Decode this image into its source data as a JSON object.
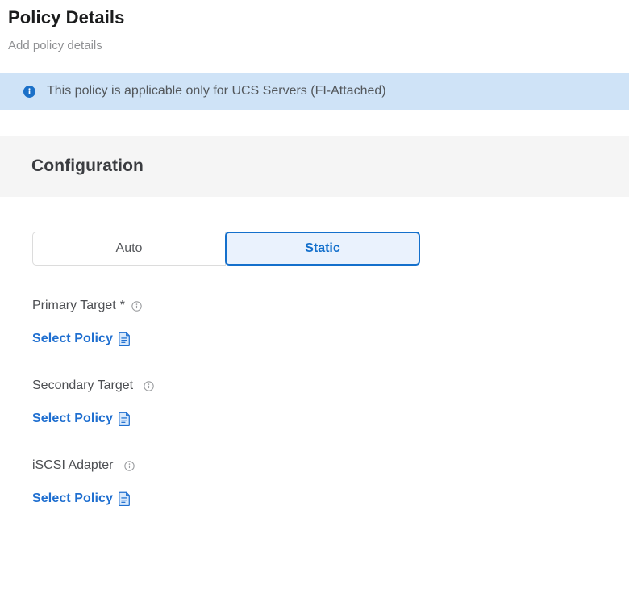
{
  "header": {
    "title": "Policy Details",
    "subtitle": "Add policy details"
  },
  "info_banner": {
    "icon": "info-circle-icon",
    "message": "This policy is applicable only for UCS Servers (FI-Attached)",
    "background_color": "#cfe3f7",
    "icon_color": "#1b70c8",
    "text_color": "#53575b"
  },
  "configuration": {
    "section_title": "Configuration",
    "section_background_color": "#f5f5f5",
    "mode_toggle": {
      "options": [
        {
          "label": "Auto",
          "selected": false
        },
        {
          "label": "Static",
          "selected": true
        }
      ],
      "selected_value": "Static",
      "selected_color": "#1470cc",
      "selected_background": "#eaf2fd"
    },
    "fields": [
      {
        "label": "Primary Target",
        "required": true,
        "required_marker": "*",
        "help_icon": "info-circle-outline-icon",
        "action_label": "Select Policy",
        "action_icon": "document-policy-icon",
        "value": ""
      },
      {
        "label": "Secondary Target",
        "required": false,
        "required_marker": "",
        "help_icon": "info-circle-outline-icon",
        "action_label": "Select Policy",
        "action_icon": "document-policy-icon",
        "value": ""
      },
      {
        "label": "iSCSI Adapter",
        "required": false,
        "required_marker": "",
        "help_icon": "info-circle-outline-icon",
        "action_label": "Select Policy",
        "action_icon": "document-policy-icon",
        "value": ""
      }
    ],
    "link_color": "#1f6fd0"
  }
}
